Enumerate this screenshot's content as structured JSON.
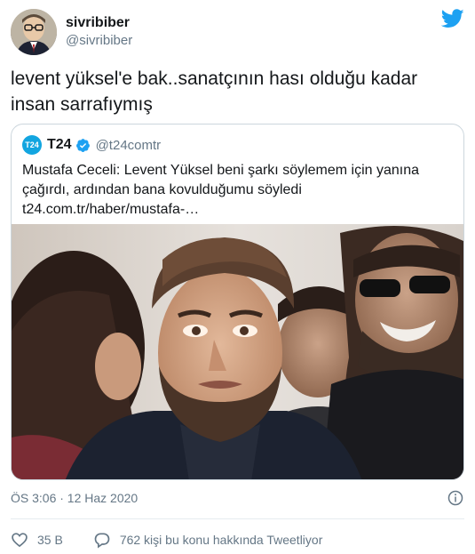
{
  "author": {
    "display_name": "sivribiber",
    "handle": "@sivribiber"
  },
  "tweet": {
    "text": "levent yüksel'e bak..sanatçının hası olduğu kadar insan sarrafıymış",
    "timestamp": "ÖS 3:06 · 12 Haz 2020"
  },
  "quoted": {
    "logo_text": "T24",
    "display_name": "T24",
    "handle": "@t24comtr",
    "text": "Mustafa Ceceli: Levent Yüksel beni şarkı söylemem için yanına çağırdı, ardından bana kovulduğumu söyledi t24.com.tr/haber/mustafa-…"
  },
  "actions": {
    "likes": "35 B",
    "replies_text": "762 kişi bu konu hakkında Tweetliyor"
  },
  "colors": {
    "twitter_blue": "#1da1f2",
    "like_red": "#e0245e",
    "muted": "#657786",
    "border": "#ccd6dd",
    "t24_blue": "#12a5e0"
  },
  "icons": {
    "brand": "twitter-bird-icon",
    "verified": "verified-badge-icon",
    "info": "info-icon",
    "like": "heart-icon",
    "reply": "speech-bubble-icon"
  }
}
